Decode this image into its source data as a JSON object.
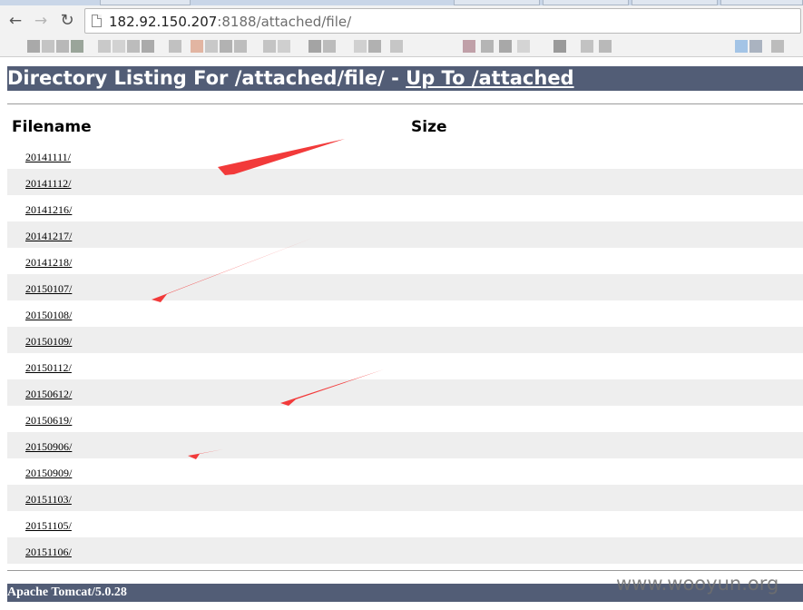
{
  "browser": {
    "address": {
      "host": "182.92.150.207",
      "port_path": ":8188/attached/file/"
    },
    "nav_icons": {
      "back": "←",
      "forward": "→",
      "reload": "↻"
    },
    "bookmark_colors": [
      "#a9a9a9",
      "#c4c4c4",
      "#b8b8b8",
      "#9aa59a",
      "#c9c9c9",
      "#d2d2d2",
      "#bcbcbc",
      "#aaaaaa",
      "#c1c1c1",
      "#e2b5a2",
      "#c8c8c8",
      "#b2b2b2",
      "#bdbdbd",
      "#c4c4c4",
      "#cfcfcf",
      "#a4a4a4",
      "#bcbcbc",
      "#d0d0d0",
      "#b1b1b1",
      "#c6c6c6",
      "#c0a0a8",
      "#b5b5b5",
      "#a8a8a8",
      "#d4d4d4",
      "#9a9a9a",
      "#c2c2c2",
      "#b9b9b9",
      "#a3c4e6",
      "#aab3c0",
      "#bcbcbc"
    ]
  },
  "page": {
    "header_prefix": "Directory Listing For /attached/file/ - ",
    "up_link": "Up To /attached",
    "columns": {
      "filename": "Filename",
      "size": "Size"
    },
    "rows": [
      "20141111/",
      "20141112/",
      "20141216/",
      "20141217/",
      "20141218/",
      "20150107/",
      "20150108/",
      "20150109/",
      "20150112/",
      "20150612/",
      "20150619/",
      "20150906/",
      "20150909/",
      "20151103/",
      "20151105/",
      "20151106/"
    ],
    "footer": "Apache Tomcat/5.0.28",
    "header_color": "#525d76",
    "stripe_color": "#eeeeee"
  },
  "annotations": {
    "arrow_color": "#f23a3a"
  },
  "watermark": "www.wooyun.org"
}
